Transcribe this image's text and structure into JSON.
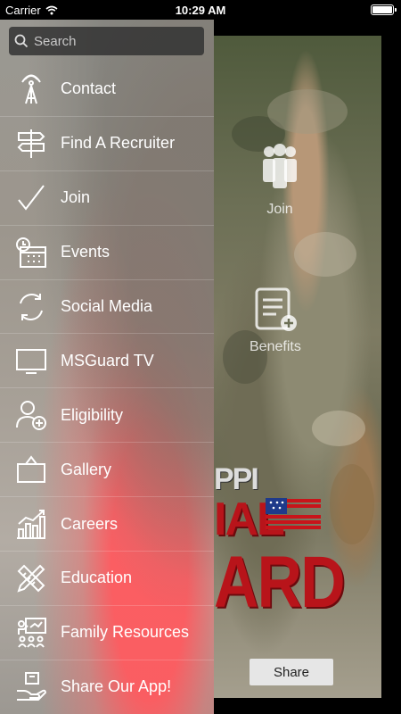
{
  "status_bar": {
    "carrier": "Carrier",
    "time": "10:29 AM"
  },
  "search": {
    "placeholder": "Search"
  },
  "menu": {
    "items": [
      {
        "label": "Contact",
        "icon": "antenna-icon"
      },
      {
        "label": "Find A Recruiter",
        "icon": "signpost-icon"
      },
      {
        "label": "Join",
        "icon": "checkmark-icon"
      },
      {
        "label": "Events",
        "icon": "calendar-clock-icon"
      },
      {
        "label": "Social Media",
        "icon": "refresh-arrows-icon"
      },
      {
        "label": "MSGuard TV",
        "icon": "tv-icon"
      },
      {
        "label": "Eligibility",
        "icon": "user-add-icon"
      },
      {
        "label": "Gallery",
        "icon": "picture-frame-icon"
      },
      {
        "label": "Careers",
        "icon": "bar-chart-icon"
      },
      {
        "label": "Education",
        "icon": "pencil-ruler-icon"
      },
      {
        "label": "Family Resources",
        "icon": "presentation-icon"
      },
      {
        "label": "Share Our App!",
        "icon": "hand-box-icon"
      }
    ]
  },
  "background": {
    "brand_line_1": "PPI",
    "brand_line_2": "IAL",
    "brand_line_3": "ARD",
    "join_label": "Join",
    "benefits_label": "Benefits",
    "share_label": "Share"
  },
  "colors": {
    "brand_red": "#b8141a",
    "menu_highlight": "#ff5a5f"
  }
}
